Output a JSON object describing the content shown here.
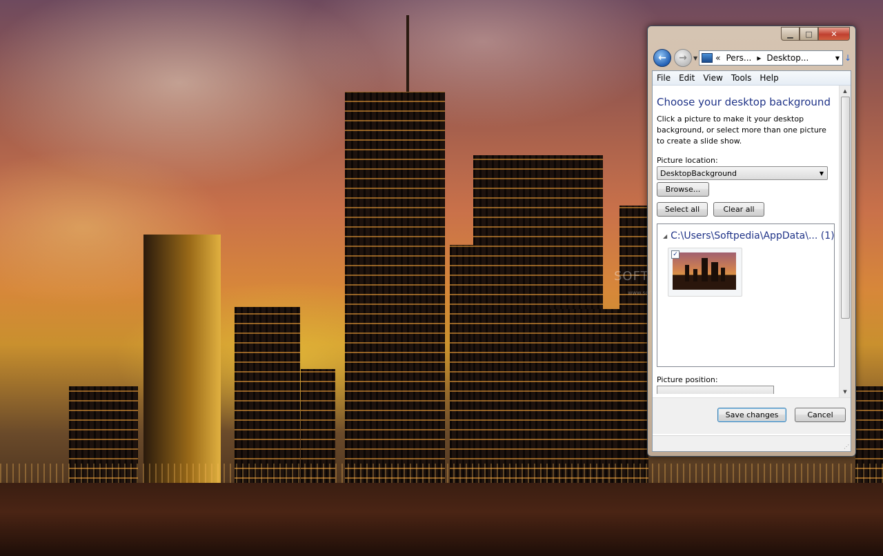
{
  "window": {
    "caption_buttons": {
      "minimize_icon": "minimize-icon",
      "maximize_icon": "maximize-icon",
      "close_icon": "close-icon"
    },
    "nav": {
      "back_icon": "back-arrow-icon",
      "forward_icon": "forward-arrow-icon",
      "recent_icon": "chevron-down-icon",
      "address_prefix": "«",
      "breadcrumb": [
        "Pers...",
        "Desktop..."
      ],
      "refresh_icon": "refresh-icon"
    },
    "menu": [
      "File",
      "Edit",
      "View",
      "Tools",
      "Help"
    ],
    "title": "Choose your desktop background",
    "description": "Click a picture to make it your desktop background, or select more than one picture to create a slide show.",
    "picture_location_label": "Picture location:",
    "picture_location_value": "DesktopBackground",
    "browse_label": "Browse...",
    "select_all_label": "Select all",
    "clear_all_label": "Clear all",
    "group_header": "C:\\Users\\Softpedia\\AppData\\... (1)",
    "thumbnail": {
      "checked": true,
      "check_glyph": "✓"
    },
    "picture_position_label": "Picture position:",
    "save_label": "Save changes",
    "cancel_label": "Cancel"
  },
  "watermark": {
    "text": "SOFTPEDIA",
    "url": "www.softpedia.com"
  },
  "colors": {
    "title_blue": "#1e3287",
    "close_red": "#c04030",
    "accent_blue": "#2360b4"
  }
}
